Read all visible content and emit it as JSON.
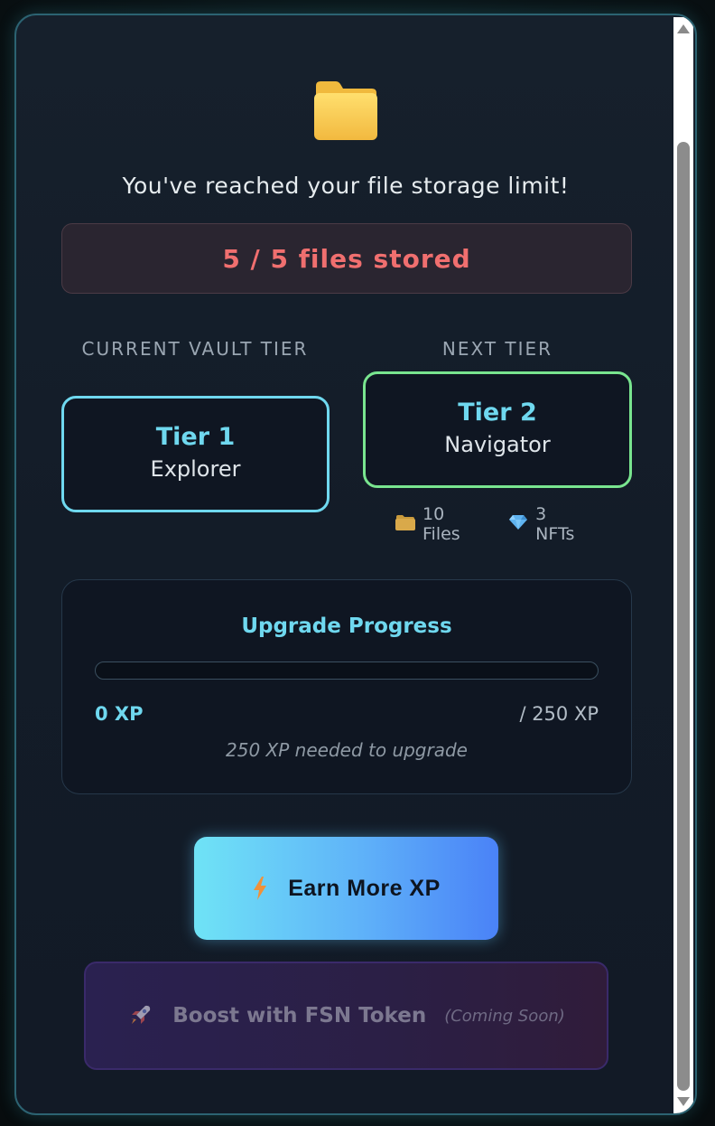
{
  "modal": {
    "icon": "folder-icon",
    "headline": "You've reached your file storage limit!",
    "limit_text": "5 / 5 files stored"
  },
  "tiers": {
    "current_label": "CURRENT VAULT TIER",
    "next_label": "NEXT TIER",
    "current": {
      "tier": "Tier 1",
      "name": "Explorer"
    },
    "next": {
      "tier": "Tier 2",
      "name": "Navigator"
    },
    "next_perks": [
      {
        "icon": "folder-icon",
        "text": "10 Files"
      },
      {
        "icon": "gem-icon",
        "text": "3 NFTs"
      }
    ]
  },
  "progress": {
    "title": "Upgrade Progress",
    "current_xp": "0 XP",
    "total_xp": "/ 250 XP",
    "needed_text": "250 XP needed to upgrade",
    "fill_fraction": 0
  },
  "actions": {
    "earn_label": "Earn More XP",
    "earn_icon": "lightning-icon",
    "boost_label": "Boost with FSN Token",
    "boost_note": "(Coming Soon)",
    "boost_icon": "rocket-icon"
  },
  "colors": {
    "accent_cyan": "#6fd8ef",
    "accent_green": "#79e58f",
    "limit_red": "#f06f6f"
  }
}
